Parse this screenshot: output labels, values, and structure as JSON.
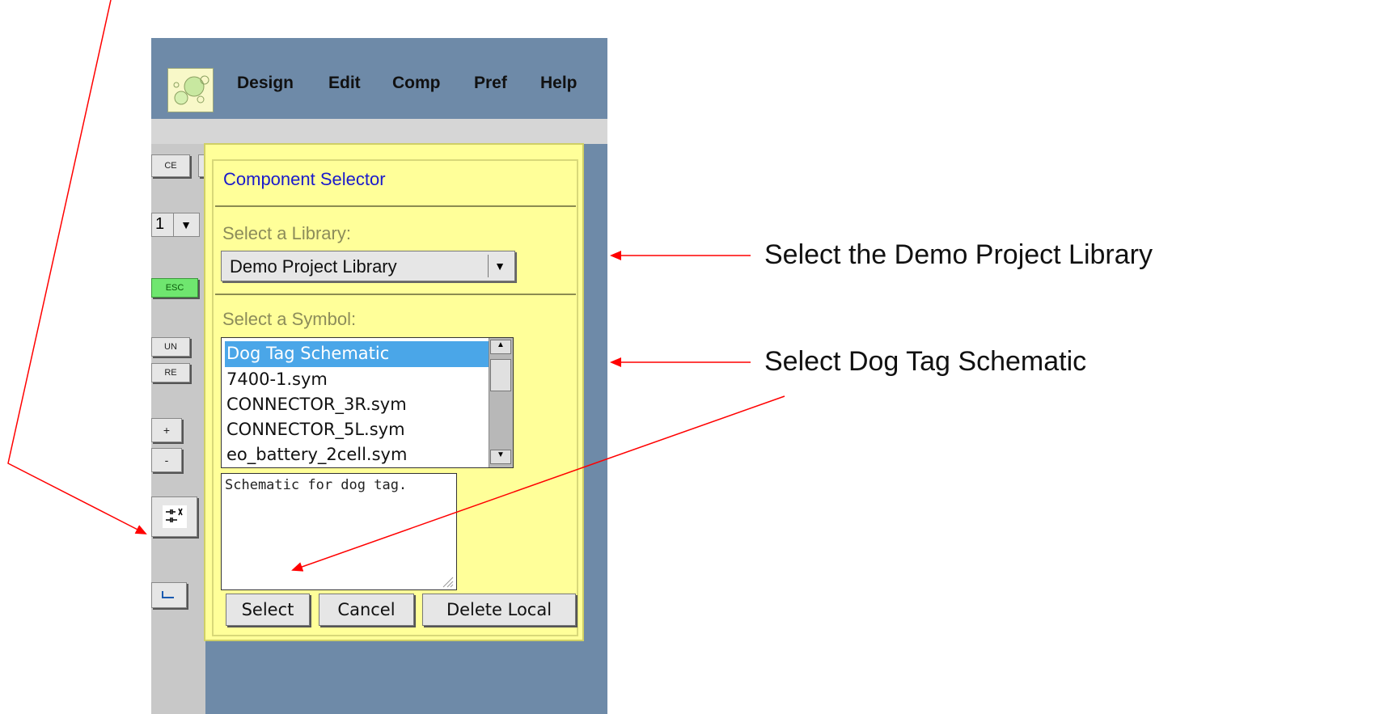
{
  "menubar": {
    "items": [
      "Design",
      "Edit",
      "Comp",
      "Pref",
      "Help"
    ]
  },
  "toolbar": {
    "ce_label": "CE",
    "page_value": "1",
    "esc_label": "ESC",
    "undo_label": "UN",
    "redo_label": "RE",
    "zoom_in_label": "+",
    "zoom_out_label": "-"
  },
  "dialog": {
    "title": "Component Selector",
    "library_label": "Select a Library:",
    "library_value": "Demo Project Library",
    "symbol_label": "Select a Symbol:",
    "symbols": [
      "Dog Tag Schematic",
      "7400-1.sym",
      "CONNECTOR_3R.sym",
      "CONNECTOR_5L.sym",
      "eo_battery_2cell.sym"
    ],
    "selected_symbol": "Dog Tag Schematic",
    "description": "Schematic for dog tag.",
    "buttons": {
      "select": "Select",
      "cancel": "Cancel",
      "delete_local": "Delete Local"
    }
  },
  "annotations": {
    "library": "Select the Demo Project Library",
    "symbol": "Select Dog Tag Schematic"
  },
  "colors": {
    "arrow": "#ff0000",
    "dialog_bg": "#ffff99",
    "window_bg": "#6e8aa8",
    "selection": "#4aa6e8"
  }
}
